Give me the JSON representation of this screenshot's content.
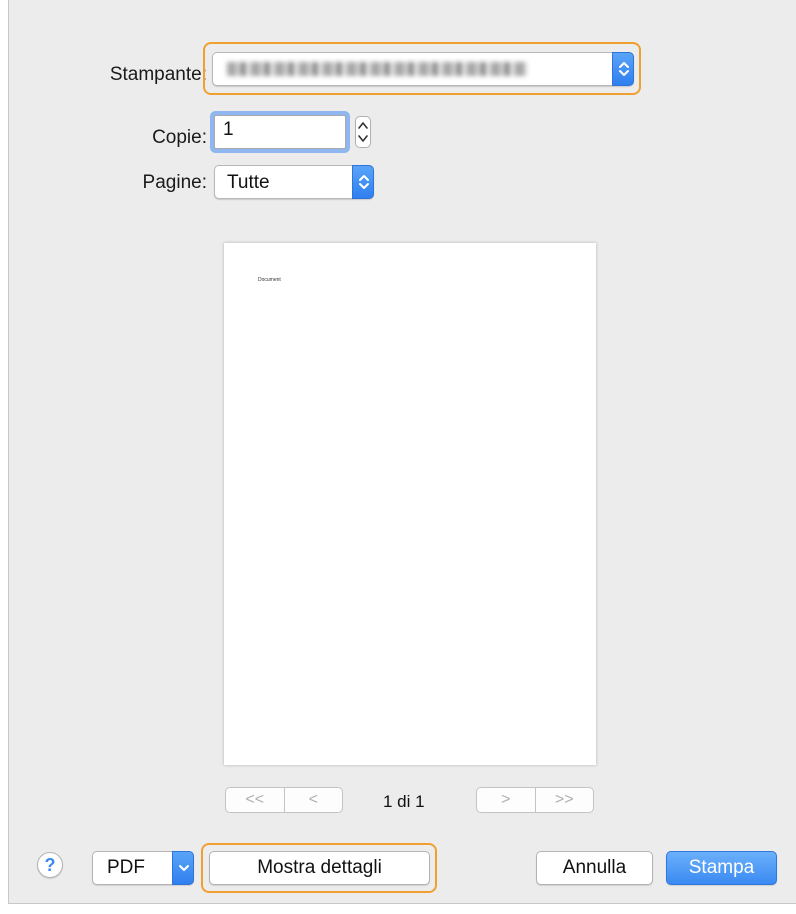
{
  "printer": {
    "label": "Stampante:",
    "value": "",
    "icon": "popup-up-down-arrows-icon"
  },
  "copies": {
    "label": "Copie:",
    "value": "1",
    "icon": "stepper-icon"
  },
  "pages": {
    "label": "Pagine:",
    "value": "Tutte",
    "icon": "popup-up-down-arrows-icon"
  },
  "preview": {
    "document_text": "Document",
    "counter": "1 di 1",
    "nav_icons": [
      "first-page-icon",
      "previous-page-icon",
      "next-page-icon",
      "last-page-icon"
    ],
    "nav_glyphs": {
      "first": "<<",
      "prev": "<",
      "next": ">",
      "last": ">>"
    }
  },
  "footer": {
    "help_label": "?",
    "pdf_label": "PDF",
    "details_label": "Mostra dettagli",
    "cancel_label": "Annulla",
    "print_label": "Stampa"
  },
  "colors": {
    "accent_blue": "#3a8af2",
    "highlight_orange": "#f0a030",
    "dialog_background": "#ececec"
  }
}
